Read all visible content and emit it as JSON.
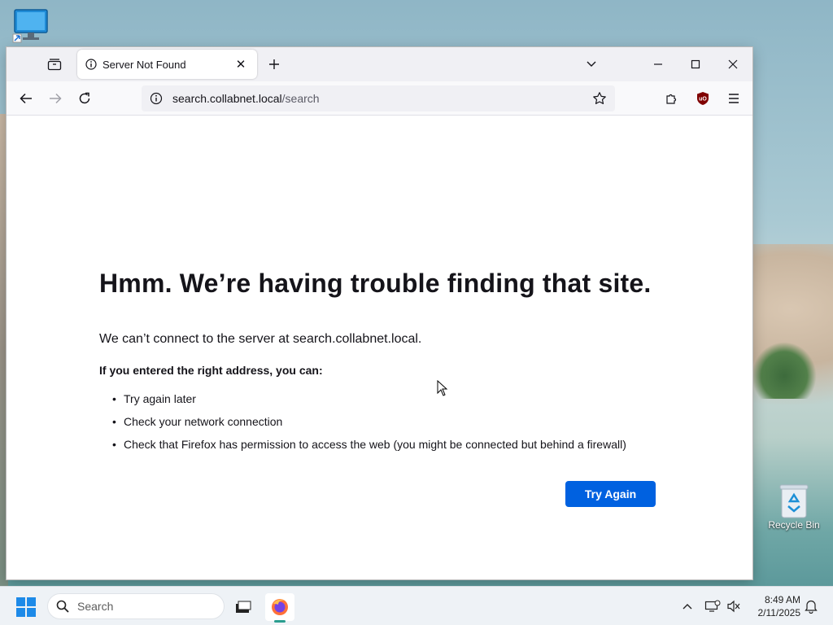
{
  "desktop": {
    "icons": [
      {
        "name": "monitor",
        "label": ""
      },
      {
        "name": "recycle-bin",
        "label": "Recycle Bin"
      }
    ]
  },
  "browser": {
    "tab": {
      "title": "Server Not Found"
    },
    "url": {
      "host": "search.collabnet.local",
      "path": "/search"
    },
    "colors": {
      "accent": "#0061e0",
      "tab_bg": "#f0f0f4"
    }
  },
  "error_page": {
    "title": "Hmm. We’re having trouble finding that site.",
    "description": "We can’t connect to the server at search.collabnet.local.",
    "subheading": "If you entered the right address, you can:",
    "suggestions": [
      "Try again later",
      "Check your network connection",
      "Check that Firefox has permission to access the web (you might be connected but behind a firewall)"
    ],
    "try_again_label": "Try Again"
  },
  "taskbar": {
    "search_label": "Search",
    "time": "8:49 AM",
    "date": "2/11/2025"
  }
}
